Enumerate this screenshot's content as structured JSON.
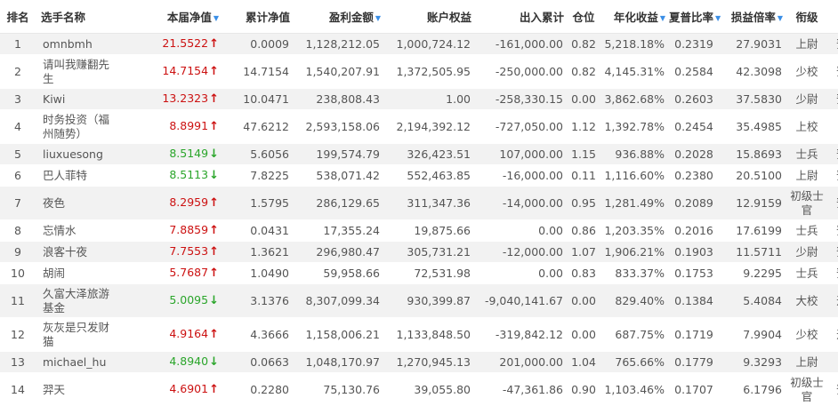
{
  "columns": [
    {
      "label": "排名",
      "sortable": false
    },
    {
      "label": "选手名称",
      "sortable": false
    },
    {
      "label": "本届净值",
      "sortable": true
    },
    {
      "label": "累计净值",
      "sortable": false
    },
    {
      "label": "盈利金额",
      "sortable": true
    },
    {
      "label": "账户权益",
      "sortable": false
    },
    {
      "label": "出入累计",
      "sortable": false
    },
    {
      "label": "仓位",
      "sortable": false
    },
    {
      "label": "年化收益",
      "sortable": true
    },
    {
      "label": "夏普比率",
      "sortable": true
    },
    {
      "label": "损益倍率",
      "sortable": true
    },
    {
      "label": "衔级",
      "sortable": false
    },
    {
      "label": "军种",
      "sortable": false
    }
  ],
  "sort_icon": "triangle-down-icon",
  "colors": {
    "up": "#cc1111",
    "down": "#2aa52a",
    "sort": "#3a8ee6",
    "stripe": "#f2f2f2"
  },
  "rows": [
    {
      "rank": "1",
      "name": "omnbmh",
      "nav": "21.5522",
      "trend": "up",
      "cum_nav": "0.0009",
      "profit": "1,128,212.05",
      "equity": "1,000,724.12",
      "flow": "-161,000.00",
      "position": "0.82",
      "annual": "5,218.18%",
      "sharpe": "0.2319",
      "pl_ratio": "27.9031",
      "rank_title": "上尉",
      "force": "预备役"
    },
    {
      "rank": "2",
      "name": "请叫我赚翻先生",
      "nav": "14.7154",
      "trend": "up",
      "cum_nav": "14.7154",
      "profit": "1,540,207.91",
      "equity": "1,372,505.95",
      "flow": "-250,000.00",
      "position": "0.82",
      "annual": "4,145.31%",
      "sharpe": "0.2584",
      "pl_ratio": "42.3098",
      "rank_title": "少校",
      "force": "预备役"
    },
    {
      "rank": "3",
      "name": "Kiwi",
      "nav": "13.2323",
      "trend": "up",
      "cum_nav": "10.0471",
      "profit": "238,808.43",
      "equity": "1.00",
      "flow": "-258,330.15",
      "position": "0.00",
      "annual": "3,862.68%",
      "sharpe": "0.2603",
      "pl_ratio": "37.5830",
      "rank_title": "少尉",
      "force": "预备役"
    },
    {
      "rank": "4",
      "name": "时务投资（福州随势）",
      "nav": "8.8991",
      "trend": "up",
      "cum_nav": "47.6212",
      "profit": "2,593,158.06",
      "equity": "2,194,392.12",
      "flow": "-727,050.00",
      "position": "1.12",
      "annual": "1,392.78%",
      "sharpe": "0.2454",
      "pl_ratio": "35.4985",
      "rank_title": "上校",
      "force": "海军"
    },
    {
      "rank": "5",
      "name": "liuxuesong",
      "nav": "8.5149",
      "trend": "down",
      "cum_nav": "5.6056",
      "profit": "199,574.79",
      "equity": "326,423.51",
      "flow": "107,000.00",
      "position": "1.15",
      "annual": "936.88%",
      "sharpe": "0.2028",
      "pl_ratio": "15.8693",
      "rank_title": "士兵",
      "force": "预备役"
    },
    {
      "rank": "6",
      "name": "巴人菲特",
      "nav": "8.5113",
      "trend": "down",
      "cum_nav": "7.8225",
      "profit": "538,071.42",
      "equity": "552,463.85",
      "flow": "-16,000.00",
      "position": "0.11",
      "annual": "1,116.60%",
      "sharpe": "0.2380",
      "pl_ratio": "20.5100",
      "rank_title": "上尉",
      "force": "预备役"
    },
    {
      "rank": "7",
      "name": "夜色",
      "nav": "8.2959",
      "trend": "up",
      "cum_nav": "1.5795",
      "profit": "286,129.65",
      "equity": "311,347.36",
      "flow": "-14,000.00",
      "position": "0.95",
      "annual": "1,281.49%",
      "sharpe": "0.2089",
      "pl_ratio": "12.9159",
      "rank_title": "初级士官",
      "force": "预备役"
    },
    {
      "rank": "8",
      "name": "忘情水",
      "nav": "7.8859",
      "trend": "up",
      "cum_nav": "0.0431",
      "profit": "17,355.24",
      "equity": "19,875.66",
      "flow": "0.00",
      "position": "0.86",
      "annual": "1,203.35%",
      "sharpe": "0.2016",
      "pl_ratio": "17.6199",
      "rank_title": "士兵",
      "force": "预备役"
    },
    {
      "rank": "9",
      "name": "浪客十夜",
      "nav": "7.7553",
      "trend": "up",
      "cum_nav": "1.3621",
      "profit": "296,980.47",
      "equity": "305,731.21",
      "flow": "-12,000.00",
      "position": "1.07",
      "annual": "1,906.21%",
      "sharpe": "0.1903",
      "pl_ratio": "11.5711",
      "rank_title": "少尉",
      "force": "预备役"
    },
    {
      "rank": "10",
      "name": "胡闹",
      "nav": "5.7687",
      "trend": "up",
      "cum_nav": "1.0490",
      "profit": "59,958.66",
      "equity": "72,531.98",
      "flow": "0.00",
      "position": "0.83",
      "annual": "833.37%",
      "sharpe": "0.1753",
      "pl_ratio": "9.2295",
      "rank_title": "士兵",
      "force": "预备役"
    },
    {
      "rank": "11",
      "name": "久富大泽旅游基金",
      "nav": "5.0095",
      "trend": "down",
      "cum_nav": "3.1376",
      "profit": "8,307,099.34",
      "equity": "930,399.87",
      "flow": "-9,040,141.67",
      "position": "0.00",
      "annual": "829.40%",
      "sharpe": "0.1384",
      "pl_ratio": "5.4084",
      "rank_title": "大校",
      "force": "远征军"
    },
    {
      "rank": "12",
      "name": "灰灰是只发财猫",
      "nav": "4.9164",
      "trend": "up",
      "cum_nav": "4.3666",
      "profit": "1,158,006.21",
      "equity": "1,133,848.50",
      "flow": "-319,842.12",
      "position": "0.00",
      "annual": "687.75%",
      "sharpe": "0.1719",
      "pl_ratio": "7.9904",
      "rank_title": "少校",
      "force": "远征军"
    },
    {
      "rank": "13",
      "name": "michael_hu",
      "nav": "4.8940",
      "trend": "down",
      "cum_nav": "0.0663",
      "profit": "1,048,170.97",
      "equity": "1,270,945.13",
      "flow": "201,000.00",
      "position": "1.04",
      "annual": "765.66%",
      "sharpe": "0.1779",
      "pl_ratio": "9.3293",
      "rank_title": "上尉",
      "force": "陆军"
    },
    {
      "rank": "14",
      "name": "羿天",
      "nav": "4.6901",
      "trend": "up",
      "cum_nav": "0.2280",
      "profit": "75,130.76",
      "equity": "39,055.80",
      "flow": "-47,361.86",
      "position": "0.90",
      "annual": "1,103.46%",
      "sharpe": "0.1707",
      "pl_ratio": "6.1796",
      "rank_title": "初级士官",
      "force": "预备役"
    }
  ]
}
